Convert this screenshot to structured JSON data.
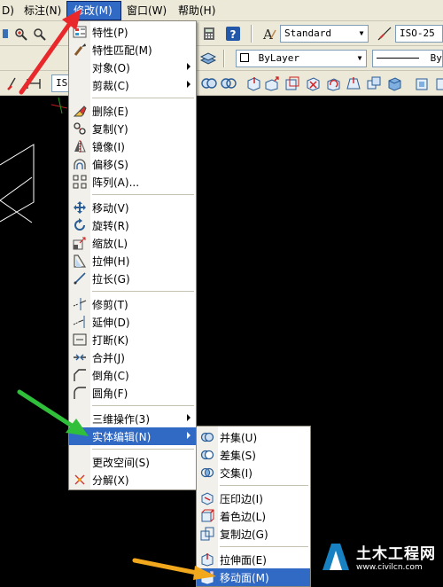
{
  "menubar": {
    "items": [
      "D)",
      "标注(N)",
      "修改(M)",
      "窗口(W)",
      "帮助(H)"
    ]
  },
  "toolbar": {
    "text_style": "Standard",
    "dim_style": "ISO-25",
    "layer_combo": "ByLayer",
    "linetype_combo": "By",
    "iso_label": "ISO"
  },
  "modify_menu": {
    "items": [
      {
        "label": "特性(P)",
        "icon": "properties-icon"
      },
      {
        "label": "特性匹配(M)",
        "icon": "match-properties-icon"
      },
      {
        "label": "对象(O)",
        "submenu": true
      },
      {
        "label": "剪裁(C)",
        "submenu": true
      },
      {
        "label": "删除(E)",
        "icon": "erase-icon"
      },
      {
        "label": "复制(Y)",
        "icon": "copy-icon"
      },
      {
        "label": "镜像(I)",
        "icon": "mirror-icon"
      },
      {
        "label": "偏移(S)",
        "icon": "offset-icon"
      },
      {
        "label": "阵列(A)...",
        "icon": "array-icon"
      },
      {
        "label": "移动(V)",
        "icon": "move-icon"
      },
      {
        "label": "旋转(R)",
        "icon": "rotate-icon"
      },
      {
        "label": "缩放(L)",
        "icon": "scale-icon"
      },
      {
        "label": "拉伸(H)",
        "icon": "stretch-icon"
      },
      {
        "label": "拉长(G)",
        "icon": "lengthen-icon"
      },
      {
        "label": "修剪(T)",
        "icon": "trim-icon"
      },
      {
        "label": "延伸(D)",
        "icon": "extend-icon"
      },
      {
        "label": "打断(K)",
        "icon": "break-icon"
      },
      {
        "label": "合并(J)",
        "icon": "join-icon"
      },
      {
        "label": "倒角(C)",
        "icon": "chamfer-icon"
      },
      {
        "label": "圆角(F)",
        "icon": "fillet-icon"
      },
      {
        "label": "三维操作(3)",
        "submenu": true
      },
      {
        "label": "实体编辑(N)",
        "submenu": true
      },
      {
        "label": "更改空间(S)"
      },
      {
        "label": "分解(X)",
        "icon": "explode-icon"
      }
    ]
  },
  "solid_edit_menu": {
    "items": [
      {
        "label": "并集(U)",
        "icon": "union-icon"
      },
      {
        "label": "差集(S)",
        "icon": "subtract-icon"
      },
      {
        "label": "交集(I)",
        "icon": "intersect-icon"
      },
      {
        "label": "压印边(I)",
        "icon": "imprint-icon"
      },
      {
        "label": "着色边(L)",
        "icon": "color-edges-icon"
      },
      {
        "label": "复制边(G)",
        "icon": "copy-edges-icon"
      },
      {
        "label": "拉伸面(E)",
        "icon": "extrude-faces-icon"
      },
      {
        "label": "移动面(M)",
        "icon": "move-faces-icon"
      }
    ]
  },
  "watermark": {
    "name": "土木工程网",
    "url": "www.civilcn.com"
  },
  "colors": {
    "highlight": "#316ac5",
    "chrome": "#ece9d8",
    "arrow_red": "#e8282b",
    "arrow_green": "#2fbf3a",
    "arrow_orange": "#f2a81d"
  }
}
